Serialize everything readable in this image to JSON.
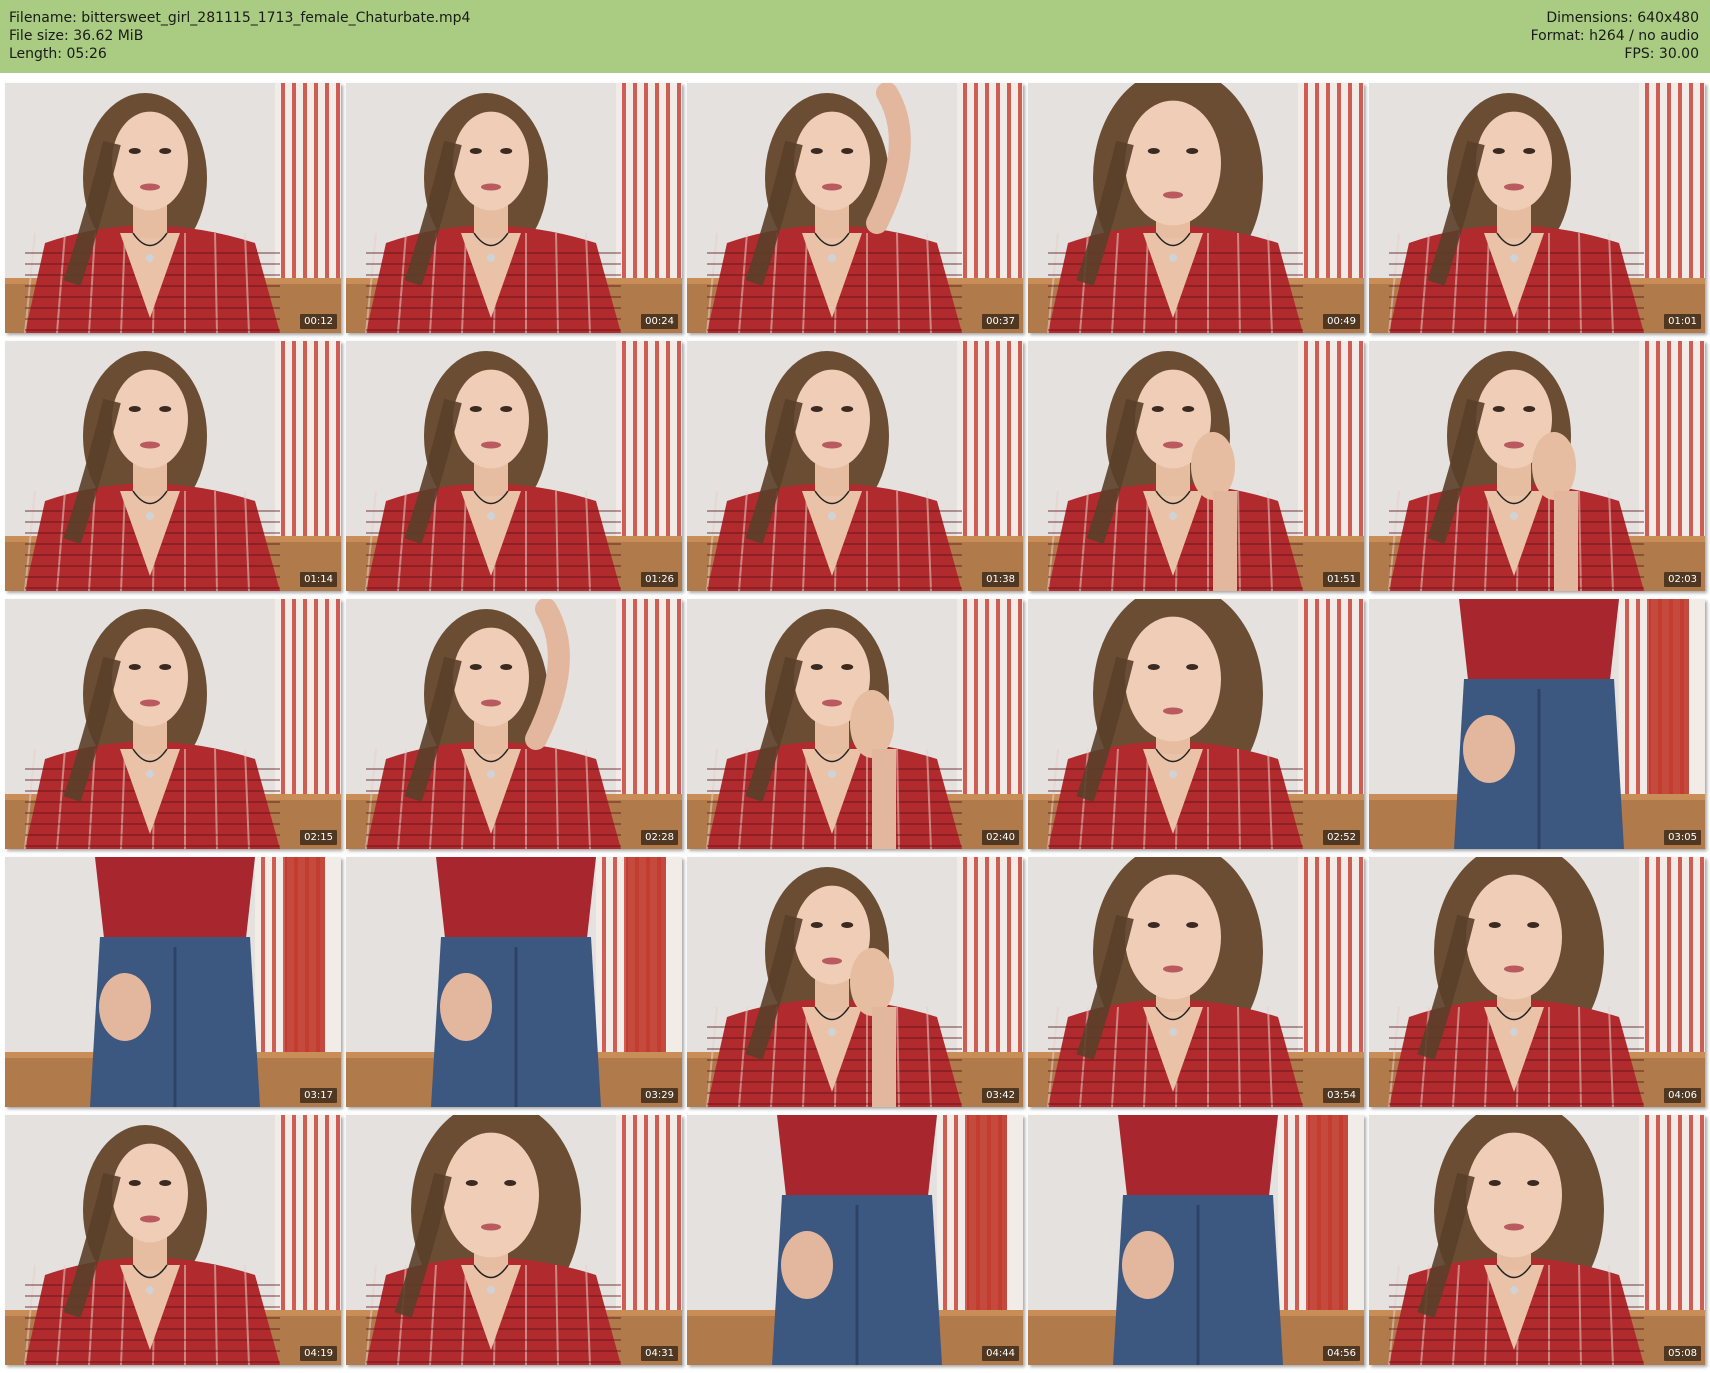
{
  "header": {
    "left": [
      "Filename: bittersweet_girl_281115_1713_female_Chaturbate.mp4",
      "File size: 36.62 MiB",
      "Length: 05:26"
    ],
    "right": [
      "Dimensions: 640x480",
      "Format: h264 / no audio",
      "FPS: 30.00"
    ],
    "background_color": "#aacb82"
  },
  "thumbnails": [
    {
      "time": "00:12"
    },
    {
      "time": "00:24"
    },
    {
      "time": "00:37"
    },
    {
      "time": "00:49"
    },
    {
      "time": "01:01"
    },
    {
      "time": "01:14"
    },
    {
      "time": "01:26"
    },
    {
      "time": "01:38"
    },
    {
      "time": "01:51"
    },
    {
      "time": "02:03"
    },
    {
      "time": "02:15"
    },
    {
      "time": "02:28"
    },
    {
      "time": "02:40"
    },
    {
      "time": "02:52"
    },
    {
      "time": "03:05"
    },
    {
      "time": "03:17"
    },
    {
      "time": "03:29"
    },
    {
      "time": "03:42"
    },
    {
      "time": "03:54"
    },
    {
      "time": "04:06"
    },
    {
      "time": "04:19"
    },
    {
      "time": "04:31"
    },
    {
      "time": "04:44"
    },
    {
      "time": "04:56"
    },
    {
      "time": "05:08"
    }
  ]
}
